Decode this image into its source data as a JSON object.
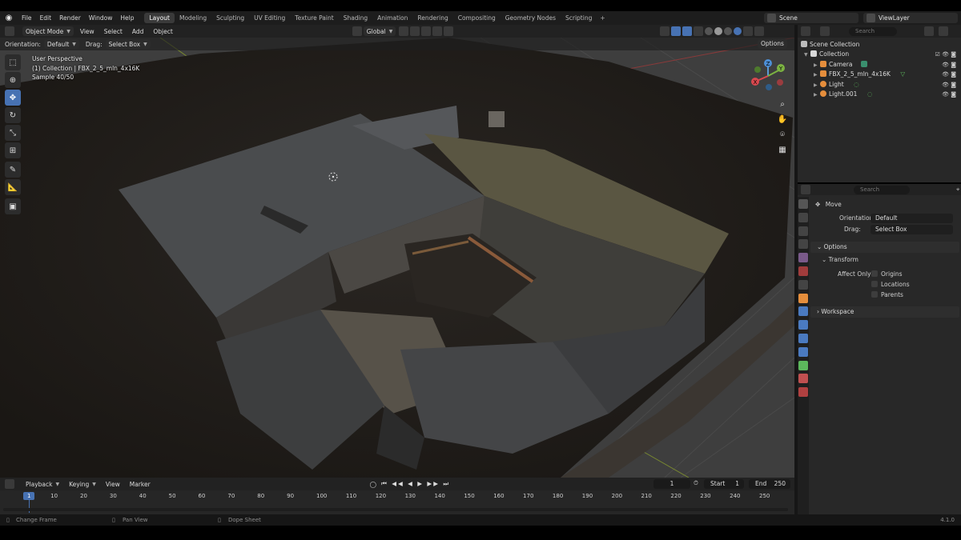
{
  "menu": [
    "File",
    "Edit",
    "Render",
    "Window",
    "Help"
  ],
  "workspaces": [
    "Layout",
    "Modeling",
    "Sculpting",
    "UV Editing",
    "Texture Paint",
    "Shading",
    "Animation",
    "Rendering",
    "Compositing",
    "Geometry Nodes",
    "Scripting"
  ],
  "workspace_add": "+",
  "scene": {
    "label": "Scene",
    "viewlayer": "ViewLayer"
  },
  "vp_header": {
    "mode": "Object Mode",
    "view": "View",
    "select": "Select",
    "add": "Add",
    "object": "Object",
    "transform": "Global"
  },
  "vp_sub": {
    "orientation_label": "Orientation:",
    "orientation_value": "Default",
    "drag_label": "Drag:",
    "drag_value": "Select Box",
    "options": "Options"
  },
  "vp_info": {
    "line1": "User Perspective",
    "line2": "(1) Collection | FBX_2_5_mln_4x16K",
    "line3": "Sample 40/50"
  },
  "gizmo": {
    "z": "Z",
    "y": "Y",
    "x": "X"
  },
  "outliner": {
    "search_placeholder": "Search",
    "root": "Scene Collection",
    "collection": "Collection",
    "items": [
      {
        "name": "Camera",
        "color": "#e58e3c"
      },
      {
        "name": "FBX_2_5_mln_4x16K",
        "color": "#e58e3c"
      },
      {
        "name": "Light",
        "color": "#e58e3c"
      },
      {
        "name": "Light.001",
        "color": "#e58e3c"
      }
    ]
  },
  "props": {
    "search_placeholder": "Search",
    "tool": "Move",
    "orientation_label": "Orientation",
    "orientation_value": "Default",
    "drag_label": "Drag:",
    "drag_value": "Select Box",
    "options": "Options",
    "transform": "Transform",
    "affect_only": "Affect Only",
    "origins": "Origins",
    "locations": "Locations",
    "parents": "Parents",
    "workspace": "Workspace"
  },
  "timeline": {
    "playback": "Playback",
    "keying": "Keying",
    "view": "View",
    "marker": "Marker",
    "current": "1",
    "start_label": "Start",
    "start": "1",
    "end_label": "End",
    "end": "250",
    "ticks": [
      "1",
      "10",
      "20",
      "30",
      "40",
      "50",
      "60",
      "70",
      "80",
      "90",
      "100",
      "110",
      "120",
      "130",
      "140",
      "150",
      "160",
      "170",
      "180",
      "190",
      "200",
      "210",
      "220",
      "230",
      "240",
      "250"
    ]
  },
  "status": {
    "change_frame": "Change Frame",
    "pan_view": "Pan View",
    "dope_sheet": "Dope Sheet",
    "version": "4.1.0"
  }
}
